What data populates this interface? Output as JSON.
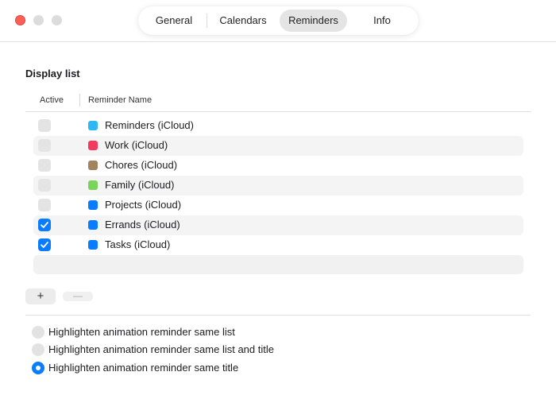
{
  "window": {
    "controls": [
      "close",
      "minimize",
      "zoom"
    ]
  },
  "tabs": [
    {
      "label": "General",
      "selected": false
    },
    {
      "label": "Calendars",
      "selected": false
    },
    {
      "label": "Reminders",
      "selected": true
    },
    {
      "label": "Info",
      "selected": false
    }
  ],
  "display_list": {
    "title": "Display list",
    "columns": {
      "active": "Active",
      "name": "Reminder Name"
    },
    "rows": [
      {
        "name": "Reminders (iCloud)",
        "active": false,
        "color": "#2eb7f5"
      },
      {
        "name": "Work (iCloud)",
        "active": false,
        "color": "#f33a5e"
      },
      {
        "name": "Chores (iCloud)",
        "active": false,
        "color": "#a2845e"
      },
      {
        "name": "Family (iCloud)",
        "active": false,
        "color": "#78d45a"
      },
      {
        "name": "Projects (iCloud)",
        "active": false,
        "color": "#0a7cff"
      },
      {
        "name": "Errands (iCloud)",
        "active": true,
        "color": "#0a7cff"
      },
      {
        "name": "Tasks (iCloud)",
        "active": true,
        "color": "#0a7cff"
      }
    ]
  },
  "buttons": {
    "add_label": "+",
    "remove_label": "—"
  },
  "highlight_options": [
    {
      "label": "Highlighten animation reminder same list",
      "selected": false
    },
    {
      "label": "Highlighten animation reminder same list and title",
      "selected": false
    },
    {
      "label": "Highlighten animation reminder same title",
      "selected": true
    }
  ],
  "colors": {
    "accent": "#0a7cff",
    "close": "#fe5f57"
  }
}
